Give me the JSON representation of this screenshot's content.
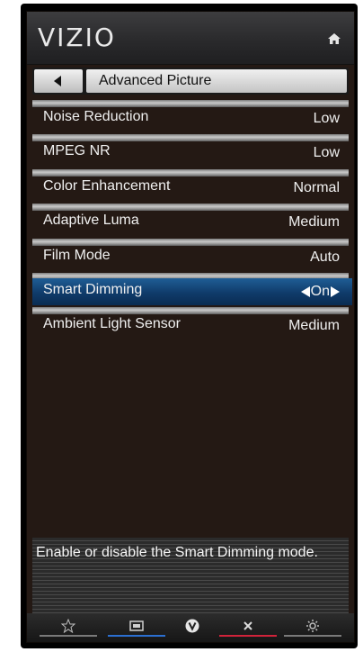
{
  "header": {
    "logo": "VIZIO",
    "home_icon": "home-icon"
  },
  "titlebar": {
    "back_icon": "back-arrow-icon",
    "title": "Advanced Picture"
  },
  "menu": {
    "items": [
      {
        "label": "Noise Reduction",
        "value": "Low"
      },
      {
        "label": "MPEG NR",
        "value": "Low"
      },
      {
        "label": "Color Enhancement",
        "value": "Normal"
      },
      {
        "label": "Adaptive Luma",
        "value": "Medium"
      },
      {
        "label": "Film Mode",
        "value": "Auto"
      },
      {
        "label": "Smart Dimming",
        "value": "On"
      },
      {
        "label": "Ambient Light Sensor",
        "value": "Medium"
      }
    ],
    "selected_index": 5
  },
  "description": "Enable or disable the Smart Dimming mode.",
  "bottom_bar": {
    "items": [
      {
        "icon": "star-icon",
        "color": "#7a7a7a"
      },
      {
        "icon": "widescreen-icon",
        "color": "#2b6fd1"
      },
      {
        "icon": "vizio-v-icon",
        "color": "#ffffff"
      },
      {
        "icon": "close-icon",
        "color": "#d0233a"
      },
      {
        "icon": "gear-icon",
        "color": "#7a7a7a"
      }
    ]
  },
  "colors": {
    "selected_row": "#1f5d95",
    "panel_bg": "#241914"
  }
}
